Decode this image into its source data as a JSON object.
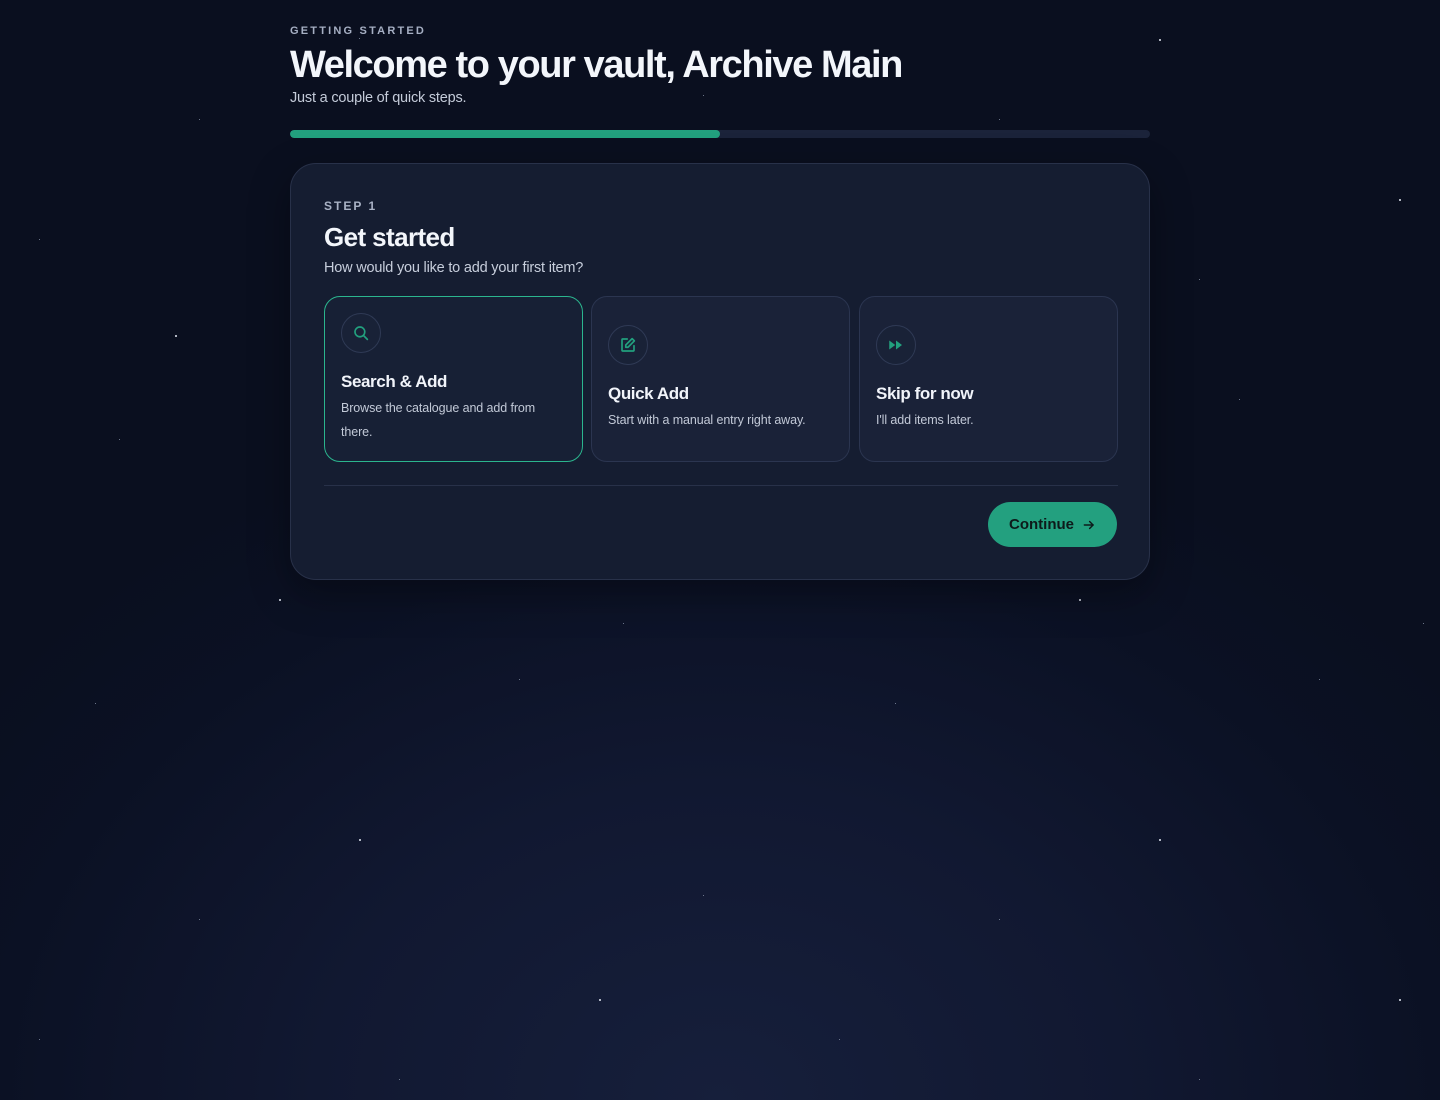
{
  "header": {
    "eyebrow": "GETTING STARTED",
    "title": "Welcome to your vault, Archive Main",
    "subtitle": "Just a couple of quick steps."
  },
  "progress": {
    "fraction": 0.5,
    "color": "#22a07e"
  },
  "step": {
    "label": "STEP 1",
    "title": "Get started",
    "question": "How would you like to add your first item?"
  },
  "options": [
    {
      "title": "Search & Add",
      "description": "Browse the catalogue and add from there.",
      "icon": "search-icon",
      "selected": true
    },
    {
      "title": "Quick Add",
      "description": "Start with a manual entry right away.",
      "icon": "edit-icon",
      "selected": false
    },
    {
      "title": "Skip for now",
      "description": "I'll add items later.",
      "icon": "fast-forward-icon",
      "selected": false
    }
  ],
  "actions": {
    "continue_label": "Continue"
  },
  "colors": {
    "accent": "#22a07e",
    "background": "#0b1124",
    "card": "#151d31"
  }
}
